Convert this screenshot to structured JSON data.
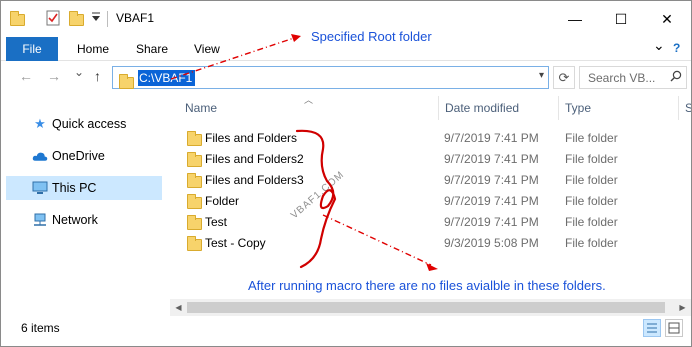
{
  "window": {
    "title": "VBAF1",
    "minimize_glyph": "—",
    "maximize_glyph": "☐",
    "close_glyph": "✕"
  },
  "ribbon": {
    "tabs": [
      {
        "label": "File"
      },
      {
        "label": "Home"
      },
      {
        "label": "Share"
      },
      {
        "label": "View"
      }
    ],
    "expand_glyph": "⌄",
    "help_glyph": "?"
  },
  "address_bar": {
    "path": "C:\\VBAF1",
    "search_placeholder": "Search VB..."
  },
  "navigation": {
    "back_glyph": "←",
    "forward_glyph": "→",
    "recent_glyph": "⌄",
    "up_glyph": "↑",
    "items": [
      {
        "label": "Quick access",
        "icon": "star-icon"
      },
      {
        "label": "OneDrive",
        "icon": "cloud-icon"
      },
      {
        "label": "This PC",
        "icon": "pc-icon",
        "selected": true
      },
      {
        "label": "Network",
        "icon": "network-icon"
      }
    ]
  },
  "columns": [
    "Name",
    "Date modified",
    "Type",
    "S"
  ],
  "files": [
    {
      "name": "Files and Folders",
      "date": "9/7/2019 7:41 PM",
      "type": "File folder"
    },
    {
      "name": "Files and Folders2",
      "date": "9/7/2019 7:41 PM",
      "type": "File folder"
    },
    {
      "name": "Files and Folders3",
      "date": "9/7/2019 7:41 PM",
      "type": "File folder"
    },
    {
      "name": "Folder",
      "date": "9/7/2019 7:41 PM",
      "type": "File folder"
    },
    {
      "name": "Test",
      "date": "9/7/2019 7:41 PM",
      "type": "File folder"
    },
    {
      "name": "Test - Copy",
      "date": "9/3/2019 5:08 PM",
      "type": "File folder"
    }
  ],
  "status": {
    "item_count": "6 items"
  },
  "annotations": {
    "root_label": "Specified Root folder",
    "note": "After running macro there are no files avialble in these folders.",
    "watermark": "VBAF1.COM"
  },
  "colors": {
    "accent": "#1a6fc4",
    "selection": "#0a64d7",
    "nav_selected": "#cce8ff",
    "annotation_blue": "#1a52d9",
    "annotation_red": "#e00000",
    "folder_yellow": "#f7d36b"
  }
}
